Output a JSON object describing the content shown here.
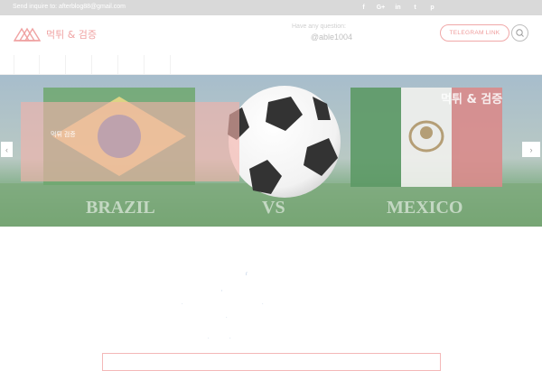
{
  "topbar": {
    "email_text": "Send inquire to: afterblog88@gmail.com",
    "socials": [
      {
        "icon": "facebook-icon",
        "glyph": "f"
      },
      {
        "icon": "google-plus-icon",
        "glyph": "G+"
      },
      {
        "icon": "linkedin-icon",
        "glyph": "in"
      },
      {
        "icon": "twitter-icon",
        "glyph": "t"
      },
      {
        "icon": "pinterest-icon",
        "glyph": "p"
      }
    ]
  },
  "header": {
    "brand": "먹튀 & 검증",
    "question_label": "Have any question:",
    "question_contact": "@able1004",
    "telegram_button": "TELEGRAM LINK",
    "search_icon": "search-icon"
  },
  "nav": {
    "items": [
      "",
      "",
      "",
      "",
      "",
      ""
    ]
  },
  "hero": {
    "title": "먹튀 & 검증",
    "box_line1": "먹튀 검증",
    "box_line2": "",
    "team_left": "BRAZIL",
    "team_vs": "VS",
    "team_right": "MEXICO",
    "prev_icon": "‹",
    "next_icon": "›"
  },
  "colors": {
    "accent": "#f0a3a3",
    "topbar": "#d9d9d9"
  }
}
